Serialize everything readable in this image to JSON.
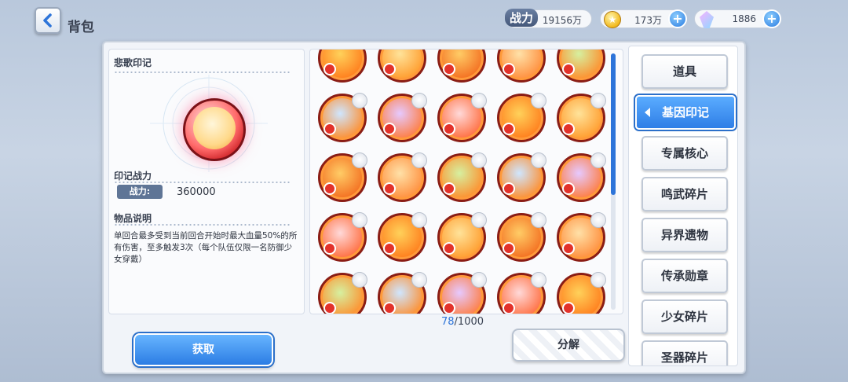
{
  "header": {
    "title": "背包"
  },
  "resources": {
    "power": {
      "label": "战力",
      "value": "19156万"
    },
    "gold": {
      "value": "173万"
    },
    "gems": {
      "value": "1886"
    }
  },
  "detail": {
    "item_name": "悲歌印记",
    "power_section": "印记战力",
    "power_tag": "战力:",
    "power_value": "360000",
    "desc_section": "物品说明",
    "description": "单回合最多受到当前回合开始时最大血量50%的所有伤害，至多触发3次（每个队伍仅限一名防御少女穿戴）"
  },
  "inventory": {
    "current": "78",
    "max": "/1000"
  },
  "buttons": {
    "obtain": "获取",
    "decompose": "分解"
  },
  "tabs": [
    "道具",
    "基因印记",
    "专属核心",
    "鸣武碎片",
    "异界遗物",
    "传承勋章",
    "少女碎片",
    "圣器碎片"
  ],
  "colors": {
    "accent": "#2d74d9",
    "item_red": "#c4151b",
    "item_orange": "#ff8c2a"
  }
}
